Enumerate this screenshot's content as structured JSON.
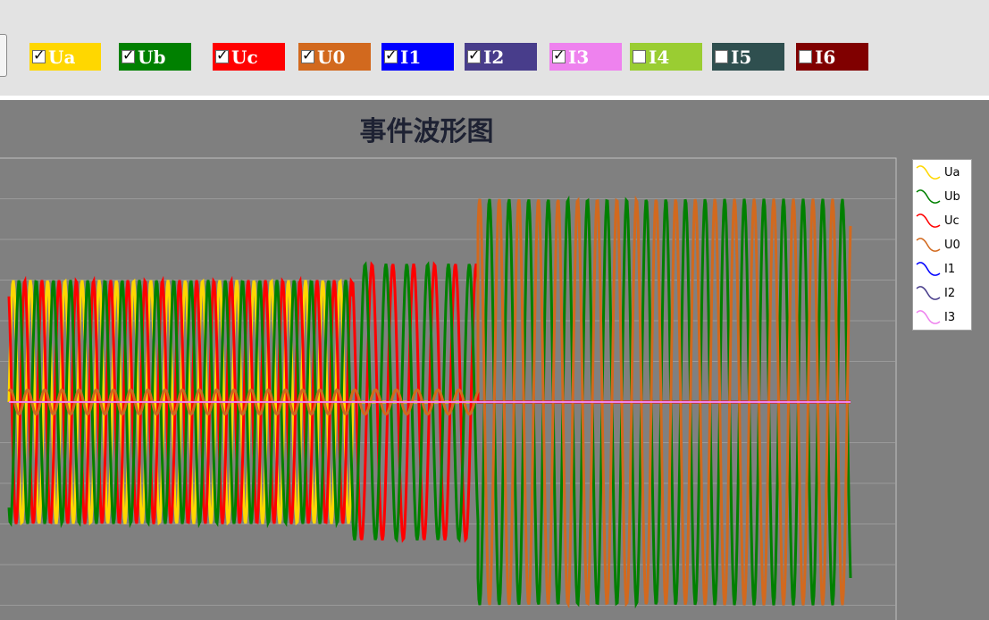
{
  "toolbar": {
    "channels": [
      {
        "label": "Ua",
        "checked": true,
        "color": "#ffd700"
      },
      {
        "label": "Ub",
        "checked": true,
        "color": "#008000"
      },
      {
        "label": "Uc",
        "checked": true,
        "color": "#ff0000"
      },
      {
        "label": "U0",
        "checked": true,
        "color": "#d2691e"
      },
      {
        "label": "I1",
        "checked": true,
        "color": "#0000ff"
      },
      {
        "label": "I2",
        "checked": true,
        "color": "#483d8b"
      },
      {
        "label": "I3",
        "checked": true,
        "color": "#ee82ee"
      },
      {
        "label": "I4",
        "checked": false,
        "color": "#9acd32"
      },
      {
        "label": "I5",
        "checked": false,
        "color": "#2f4f4f"
      },
      {
        "label": "I6",
        "checked": false,
        "color": "#800000"
      }
    ]
  },
  "chart": {
    "title": "事件波形图"
  },
  "chart_data": {
    "type": "line",
    "title": "事件波形图",
    "xlabel": "",
    "ylabel": "",
    "grid": true,
    "legend_position": "right",
    "ylim": [
      -5,
      5
    ],
    "segments": [
      {
        "x_start": 0,
        "x_end": 385,
        "periods": 20
      },
      {
        "x_start": 385,
        "x_end": 525,
        "periods": 6
      },
      {
        "x_start": 525,
        "x_end": 942,
        "periods": 19
      }
    ],
    "series": [
      {
        "name": "Ua",
        "color": "#ffd700",
        "amplitudes": [
          3,
          0,
          0
        ],
        "phase_deg": 0
      },
      {
        "name": "Ub",
        "color": "#008000",
        "amplitudes": [
          3,
          3.4,
          5
        ],
        "phase_deg": -120
      },
      {
        "name": "Uc",
        "color": "#ff0000",
        "amplitudes": [
          3,
          3.4,
          0
        ],
        "phase_deg": 120
      },
      {
        "name": "U0",
        "color": "#d2691e",
        "amplitudes": [
          0.3,
          0.3,
          5
        ],
        "phase_deg": 60
      },
      {
        "name": "I1",
        "color": "#0000ff",
        "amplitudes": [
          0,
          0,
          0
        ],
        "phase_deg": 0
      },
      {
        "name": "I2",
        "color": "#483d8b",
        "amplitudes": [
          0,
          0,
          0
        ],
        "phase_deg": 0
      },
      {
        "name": "I3",
        "color": "#ee82ee",
        "amplitudes": [
          0,
          0,
          0
        ],
        "phase_deg": 0
      }
    ]
  }
}
